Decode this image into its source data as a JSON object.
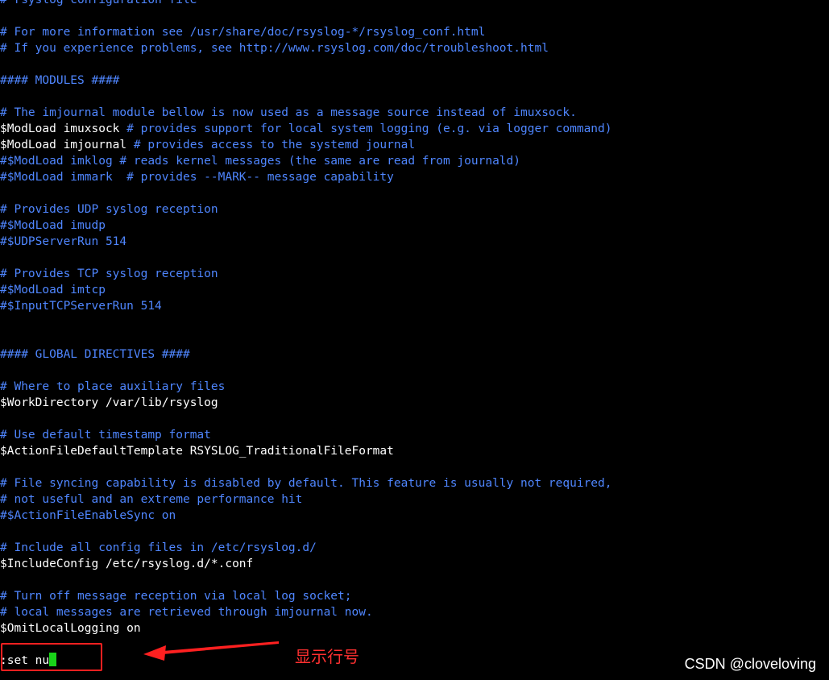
{
  "terminal": {
    "text_color": "#ffffff",
    "comment_color": "#4f86ff",
    "background": "#000000",
    "lines": [
      {
        "text": "# rsyslog configuration file",
        "kind": "comment"
      },
      {
        "text": "",
        "kind": "blank"
      },
      {
        "text": "# For more information see /usr/share/doc/rsyslog-*/rsyslog_conf.html",
        "kind": "comment"
      },
      {
        "text": "# If you experience problems, see http://www.rsyslog.com/doc/troubleshoot.html",
        "kind": "comment"
      },
      {
        "text": "",
        "kind": "blank"
      },
      {
        "text": "#### MODULES ####",
        "kind": "comment"
      },
      {
        "text": "",
        "kind": "blank"
      },
      {
        "text": "# The imjournal module bellow is now used as a message source instead of imuxsock.",
        "kind": "comment"
      },
      {
        "code": "$ModLoad imuxsock ",
        "comment": "# provides support for local system logging (e.g. via logger command)",
        "kind": "code"
      },
      {
        "code": "$ModLoad imjournal ",
        "comment": "# provides access to the systemd journal",
        "kind": "code"
      },
      {
        "text": "#$ModLoad imklog # reads kernel messages (the same are read from journald)",
        "kind": "comment"
      },
      {
        "text": "#$ModLoad immark  # provides --MARK-- message capability",
        "kind": "comment"
      },
      {
        "text": "",
        "kind": "blank"
      },
      {
        "text": "# Provides UDP syslog reception",
        "kind": "comment"
      },
      {
        "text": "#$ModLoad imudp",
        "kind": "comment"
      },
      {
        "text": "#$UDPServerRun 514",
        "kind": "comment"
      },
      {
        "text": "",
        "kind": "blank"
      },
      {
        "text": "# Provides TCP syslog reception",
        "kind": "comment"
      },
      {
        "text": "#$ModLoad imtcp",
        "kind": "comment"
      },
      {
        "text": "#$InputTCPServerRun 514",
        "kind": "comment"
      },
      {
        "text": "",
        "kind": "blank"
      },
      {
        "text": "",
        "kind": "blank"
      },
      {
        "text": "#### GLOBAL DIRECTIVES ####",
        "kind": "comment"
      },
      {
        "text": "",
        "kind": "blank"
      },
      {
        "text": "# Where to place auxiliary files",
        "kind": "comment"
      },
      {
        "text": "$WorkDirectory /var/lib/rsyslog",
        "kind": "plain"
      },
      {
        "text": "",
        "kind": "blank"
      },
      {
        "text": "# Use default timestamp format",
        "kind": "comment"
      },
      {
        "text": "$ActionFileDefaultTemplate RSYSLOG_TraditionalFileFormat",
        "kind": "plain"
      },
      {
        "text": "",
        "kind": "blank"
      },
      {
        "text": "# File syncing capability is disabled by default. This feature is usually not required,",
        "kind": "comment"
      },
      {
        "text": "# not useful and an extreme performance hit",
        "kind": "comment"
      },
      {
        "text": "#$ActionFileEnableSync on",
        "kind": "comment"
      },
      {
        "text": "",
        "kind": "blank"
      },
      {
        "text": "# Include all config files in /etc/rsyslog.d/",
        "kind": "comment"
      },
      {
        "text": "$IncludeConfig /etc/rsyslog.d/*.conf",
        "kind": "plain"
      },
      {
        "text": "",
        "kind": "blank"
      },
      {
        "text": "# Turn off message reception via local log socket;",
        "kind": "comment"
      },
      {
        "text": "# local messages are retrieved through imjournal now.",
        "kind": "comment"
      },
      {
        "text": "$OmitLocalLogging on",
        "kind": "plain"
      }
    ],
    "command_line": ":set nu",
    "cursor_color": "#19d319"
  },
  "annotation": {
    "label": "显示行号",
    "color": "#ff3030",
    "box_color": "#ff2020",
    "arrow_icon": "arrow-left-icon"
  },
  "watermark": {
    "text": "CSDN @cloveloving"
  }
}
